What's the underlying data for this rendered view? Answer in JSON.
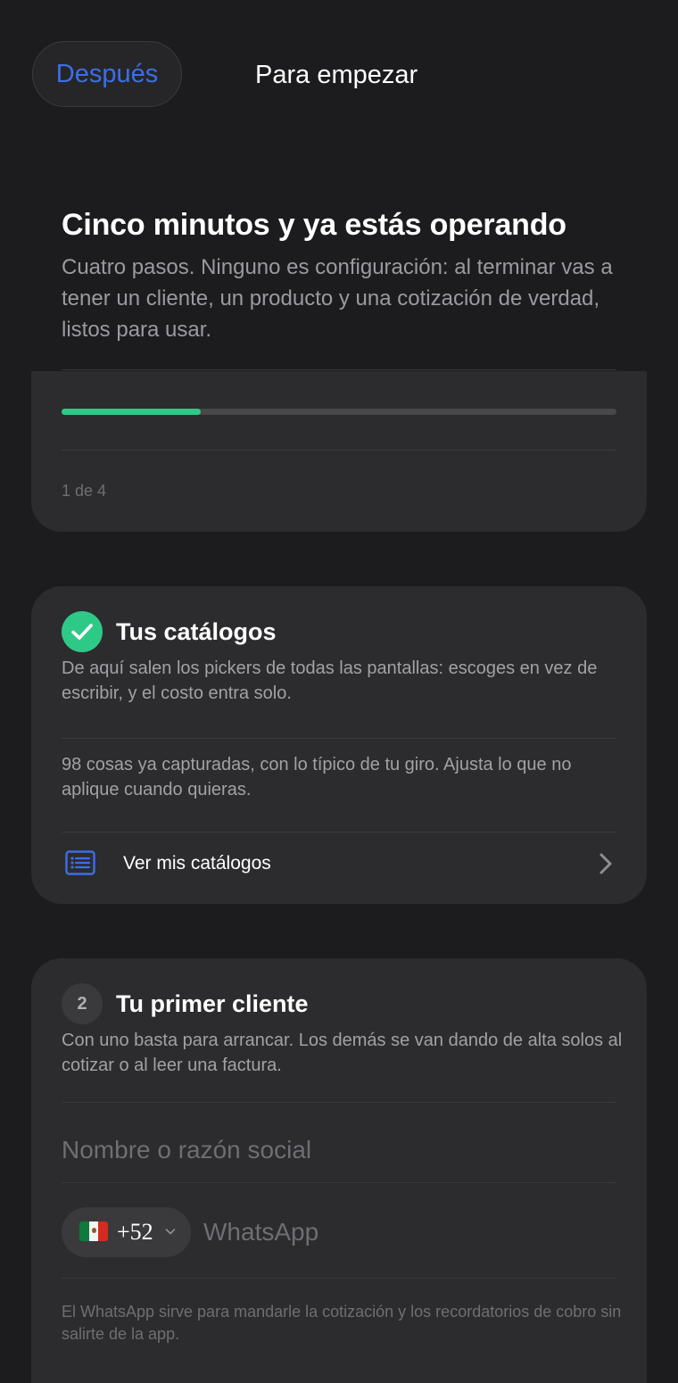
{
  "header": {
    "later_label": "Después",
    "title": "Para empezar"
  },
  "intro": {
    "title": "Cinco minutos y ya estás operando",
    "description": "Cuatro pasos. Ninguno es configuración: al terminar vas a tener un cliente, un producto y una cotización de verdad, listos para usar.",
    "progress": {
      "current": 1,
      "total": 4,
      "fraction": 0.25,
      "label": "1 de 4"
    }
  },
  "steps": [
    {
      "status": "done",
      "title": "Tus catálogos",
      "description": "De aquí salen los pickers de todas las pantallas: escoges en vez de escribir, y el costo entra solo.",
      "note": "98 cosas ya capturadas, con lo típico de tu giro. Ajusta lo que no aplique cuando quieras.",
      "link_label": "Ver mis catálogos"
    },
    {
      "status": "pending",
      "number": "2",
      "title": "Tu primer cliente",
      "description": "Con uno basta para arrancar. Los demás se van dando de alta solos al cotizar o al leer una factura.",
      "name_placeholder": "Nombre o razón social",
      "country_code": "+52",
      "whatsapp_placeholder": "WhatsApp",
      "whatsapp_help": "El WhatsApp sirve para mandarle la cotización y los recordatorios de cobro sin salirte de la app."
    }
  ],
  "colors": {
    "accent_blue": "#3b6fe8",
    "success_green": "#2fc987",
    "background": "#1c1c1e",
    "card": "#2c2c2e"
  },
  "icons": {
    "done": "checkmark-icon",
    "catalog": "list-icon",
    "link": "chevron-right-icon",
    "country": "mexico-flag-icon",
    "country_dropdown": "chevron-down-icon"
  }
}
